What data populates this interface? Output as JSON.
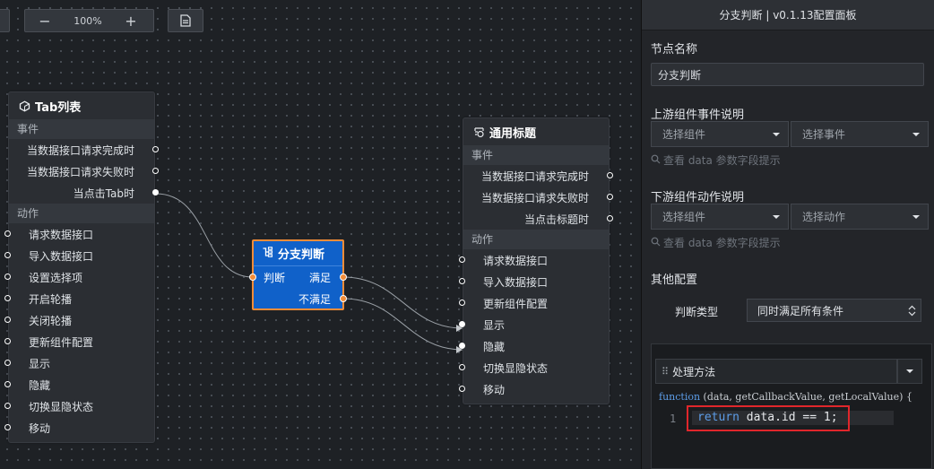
{
  "toolbar": {
    "zoom_out": "−",
    "zoom_value": "100%",
    "zoom_in": "+"
  },
  "nodes": {
    "tab_list": {
      "title": "Tab列表",
      "events_label": "事件",
      "events": [
        "当数据接口请求完成时",
        "当数据接口请求失败时",
        "当点击Tab时"
      ],
      "actions_label": "动作",
      "actions": [
        "请求数据接口",
        "导入数据接口",
        "设置选择项",
        "开启轮播",
        "关闭轮播",
        "更新组件配置",
        "显示",
        "隐藏",
        "切换显隐状态",
        "移动"
      ]
    },
    "branch": {
      "title": "分支判断",
      "input_label": "判断",
      "outputs": [
        "满足",
        "不满足"
      ]
    },
    "common_title": {
      "title": "通用标题",
      "events_label": "事件",
      "events": [
        "当数据接口请求完成时",
        "当数据接口请求失败时",
        "当点击标题时"
      ],
      "actions_label": "动作",
      "actions": [
        "请求数据接口",
        "导入数据接口",
        "更新组件配置",
        "显示",
        "隐藏",
        "切换显隐状态",
        "移动"
      ]
    }
  },
  "panel": {
    "header": "分支判断 | v0.1.13配置面板",
    "node_name_label": "节点名称",
    "node_name_value": "分支判断",
    "upstream_label": "上游组件事件说明",
    "upstream_component_placeholder": "选择组件",
    "upstream_event_placeholder": "选择事件",
    "upstream_hint": "查看 data 参数字段提示",
    "downstream_label": "下游组件动作说明",
    "downstream_component_placeholder": "选择组件",
    "downstream_action_placeholder": "选择动作",
    "downstream_hint": "查看 data 参数字段提示",
    "other_label": "其他配置",
    "judge_type_label": "判断类型",
    "judge_type_value": "同时满足所有条件",
    "handler_label": "处理方法",
    "function_keyword": "function",
    "function_signature": "(data, getCallbackValue, getLocalValue) {",
    "line_number": "1",
    "return_keyword": "return",
    "code_body": " data.id == 1;"
  },
  "colors": {
    "accent": "#1061c9",
    "port_active": "#f28c38",
    "highlight": "#e0262b"
  }
}
